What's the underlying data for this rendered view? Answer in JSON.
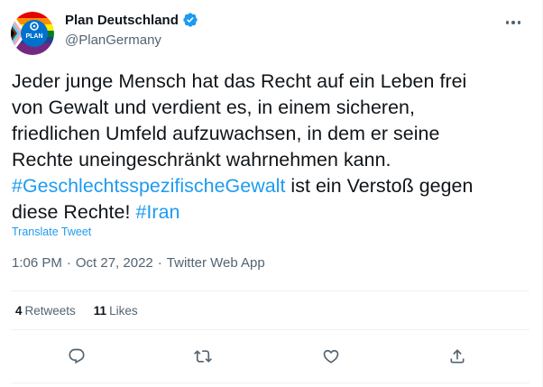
{
  "author": {
    "display_name": "Plan Deutschland",
    "handle": "@PlanGermany",
    "verified": true,
    "avatar_text": "PLAN"
  },
  "tweet": {
    "lines": [
      "Jeder junge Mensch hat das Recht auf ein Leben frei",
      "von Gewalt und verdient es, in einem sicheren,",
      "friedlichen Umfeld aufzuwachsen, in dem er seine",
      "Rechte uneingeschränkt wahrnehmen kann."
    ],
    "hashtag1": "#GeschlechtsspezifischeGewalt",
    "text_after_hashtag1": " ist ein Verstoß gegen",
    "line6_text": "diese Rechte! ",
    "hashtag2": "#Iran",
    "translate_label": "Translate Tweet"
  },
  "meta": {
    "time": "1:06 PM",
    "separator": "·",
    "date": "Oct 27, 2022",
    "app": "Twitter Web App"
  },
  "stats": {
    "retweets_count": "4",
    "retweets_label": "Retweets",
    "likes_count": "11",
    "likes_label": "Likes"
  },
  "actions": [
    "reply-icon",
    "retweet-icon",
    "like-icon",
    "share-icon"
  ],
  "colors": {
    "accent": "#1d9bf0",
    "secondary_text": "#536471",
    "primary_text": "#0f1419",
    "divider": "#eff3f4"
  }
}
